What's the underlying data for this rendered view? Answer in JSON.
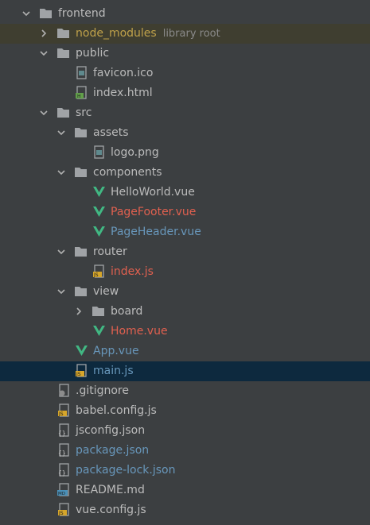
{
  "tree": {
    "items": [
      {
        "label": "frontend",
        "arrow": "down",
        "icon": "folder-icon",
        "color": "default"
      },
      {
        "label": "node_modules",
        "extra": "library root",
        "arrow": "right",
        "icon": "folder-icon",
        "color": "yellow"
      },
      {
        "label": "public",
        "arrow": "down",
        "icon": "folder-icon",
        "color": "default"
      },
      {
        "label": "favicon.ico",
        "icon": "image-file-icon",
        "color": "default"
      },
      {
        "label": "index.html",
        "icon": "html-file-icon",
        "color": "default"
      },
      {
        "label": "src",
        "arrow": "down",
        "icon": "folder-icon",
        "color": "default"
      },
      {
        "label": "assets",
        "arrow": "down",
        "icon": "folder-icon",
        "color": "default"
      },
      {
        "label": "logo.png",
        "icon": "image-file-icon",
        "color": "default"
      },
      {
        "label": "components",
        "arrow": "down",
        "icon": "folder-icon",
        "color": "default"
      },
      {
        "label": "HelloWorld.vue",
        "icon": "vue-file-icon",
        "color": "default"
      },
      {
        "label": "PageFooter.vue",
        "icon": "vue-file-icon",
        "color": "error"
      },
      {
        "label": "PageHeader.vue",
        "icon": "vue-file-icon",
        "color": "modified"
      },
      {
        "label": "router",
        "arrow": "down",
        "icon": "folder-icon",
        "color": "default"
      },
      {
        "label": "index.js",
        "icon": "js-file-icon",
        "color": "error"
      },
      {
        "label": "view",
        "arrow": "down",
        "icon": "folder-icon",
        "color": "default"
      },
      {
        "label": "board",
        "arrow": "right",
        "icon": "folder-icon",
        "color": "default"
      },
      {
        "label": "Home.vue",
        "icon": "vue-file-icon",
        "color": "error"
      },
      {
        "label": "App.vue",
        "icon": "vue-file-icon",
        "color": "modified"
      },
      {
        "label": "main.js",
        "icon": "js-file-icon",
        "color": "modified"
      },
      {
        "label": ".gitignore",
        "icon": "gitignore-file-icon",
        "color": "default"
      },
      {
        "label": "babel.config.js",
        "icon": "js-file-icon",
        "color": "default"
      },
      {
        "label": "jsconfig.json",
        "icon": "json-file-icon",
        "color": "default"
      },
      {
        "label": "package.json",
        "icon": "json-file-icon",
        "color": "modified"
      },
      {
        "label": "package-lock.json",
        "icon": "json-file-icon",
        "color": "modified"
      },
      {
        "label": "README.md",
        "icon": "markdown-file-icon",
        "color": "default"
      },
      {
        "label": "vue.config.js",
        "icon": "js-file-icon",
        "color": "default"
      }
    ]
  },
  "colors": {
    "background": "#3c3f41",
    "text_default": "#bbbbbb",
    "text_modified": "#6897bb",
    "text_error": "#e0604f",
    "text_library": "#bfa14a",
    "selection": "#0d293e",
    "highlight": "#3f3e30"
  }
}
